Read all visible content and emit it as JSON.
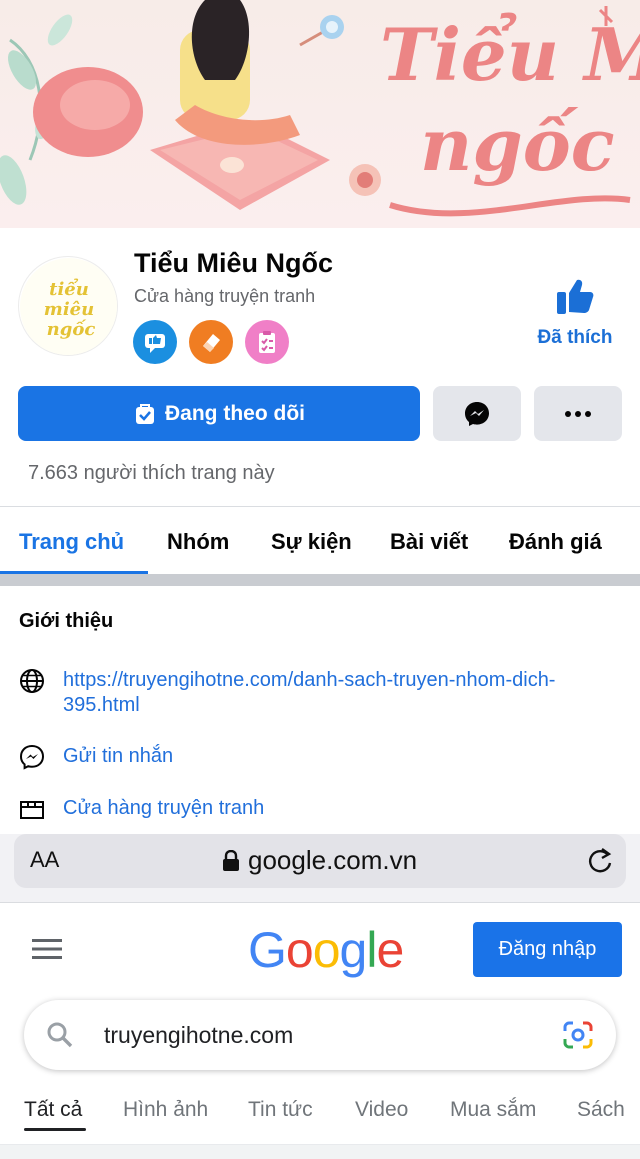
{
  "cover": {
    "lettering": "Tiểu Miêu Ngốc"
  },
  "profile": {
    "name": "Tiểu Miêu Ngốc",
    "category": "Cửa hàng truyện tranh",
    "avatar_text": "Tiểu Miêu Ngốc",
    "liked_label": "Đã thích",
    "follow_label": "Đang theo dõi",
    "likes_count": "7.663 người thích trang này"
  },
  "tabs": [
    "Trang chủ",
    "Nhóm",
    "Sự kiện",
    "Bài viết",
    "Đánh giá"
  ],
  "intro": {
    "title": "Giới thiệu",
    "website": "https://truyengihotne.com/danh-sach-truyen-nhom-dich-395.html",
    "message": "Gửi tin nhắn",
    "category": "Cửa hàng truyện tranh"
  },
  "browser": {
    "text_size_label": "AA",
    "url": "google.com.vn"
  },
  "google": {
    "logo": [
      "G",
      "o",
      "o",
      "g",
      "l",
      "e"
    ],
    "logo_colors": [
      "#4285f4",
      "#ea4335",
      "#fbbc05",
      "#4285f4",
      "#34a853",
      "#ea4335"
    ],
    "signin_label": "Đăng nhập",
    "query": "truyengihotne.com",
    "tabs": [
      "Tất cả",
      "Hình ảnh",
      "Tin tức",
      "Video",
      "Mua sắm",
      "Sách"
    ]
  },
  "colors": {
    "facebook_blue": "#1a74e4",
    "link_blue": "#216fdb",
    "google_blue": "#1a73e8"
  }
}
